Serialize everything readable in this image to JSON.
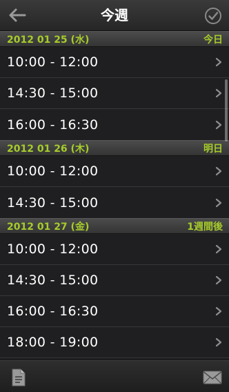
{
  "header": {
    "title": "今週",
    "back_icon": "back-arrow-icon",
    "done_icon": "checkmark-circle-icon"
  },
  "sections": [
    {
      "date": "2012 01 25 (水)",
      "relative": "今日",
      "rows": [
        "10:00 - 12:00",
        "14:30 - 15:00",
        "16:00 - 16:30"
      ]
    },
    {
      "date": "2012 01 26 (木)",
      "relative": "明日",
      "rows": [
        "10:00 - 12:00",
        "14:30 - 15:00"
      ]
    },
    {
      "date": "2012 01 27 (金)",
      "relative": "1週間後",
      "rows": [
        "10:00 - 12:00",
        "14:30 - 15:00",
        "16:00 - 16:30",
        "18:00 - 19:00"
      ]
    }
  ],
  "toolbar": {
    "left_icon": "document-icon",
    "right_icon": "mail-icon"
  },
  "colors": {
    "accent": "#a6cc2a",
    "background": "#1c1c1e"
  }
}
